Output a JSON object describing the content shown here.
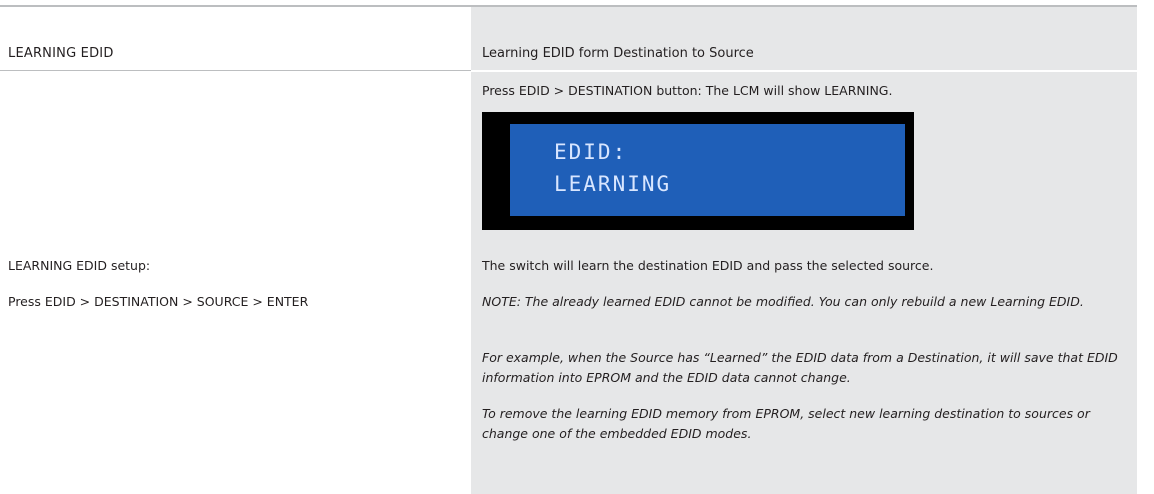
{
  "header": {
    "left_title": "LEARNING EDID",
    "right_title": "Learning EDID form Destination to Source"
  },
  "left": {
    "setup_label": "LEARNING EDID setup:",
    "setup_steps": "Press EDID > DESTINATION > SOURCE > ENTER"
  },
  "right": {
    "press_instruction": "Press EDID > DESTINATION button: The LCM will show LEARNING.",
    "lcd": {
      "line1": "EDID:",
      "line2": "LEARNING"
    },
    "learn_text": "The switch will learn the destination EDID and pass the selected source.",
    "note": "NOTE: The already learned EDID cannot be modified. You can only rebuild a new Learning EDID.",
    "example": "For example, when the Source has “Learned” the EDID data from a Destination, it will save that EDID information into EPROM and the EDID data cannot change.",
    "remove": "To remove the learning EDID memory from EPROM, select new learning destination to sources or change one of the embedded EDID modes."
  }
}
